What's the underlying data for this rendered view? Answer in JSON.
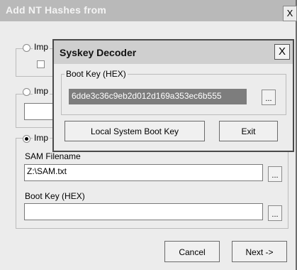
{
  "main_dialog": {
    "title": "Add NT Hashes from",
    "close_glyph": "X",
    "options": [
      {
        "label": "Imp",
        "checked": false
      },
      {
        "label": "Imp",
        "checked": false
      },
      {
        "label": "Imp",
        "checked": true
      }
    ],
    "sam_filename_label": "SAM Filename",
    "sam_filename_value": "Z:\\SAM.txt",
    "boot_key_label": "Boot Key (HEX)",
    "boot_key_value": "",
    "browse_label": "...",
    "cancel_label": "Cancel",
    "next_label": "Next ->"
  },
  "syskey_dialog": {
    "title": "Syskey Decoder",
    "close_glyph": "X",
    "boot_key_group_label": "Boot Key (HEX)",
    "boot_key_value": "6dde3c36c9eb2d012d169a353ec6b555",
    "browse_label": "...",
    "local_button_label": "Local System Boot Key",
    "exit_button_label": "Exit"
  }
}
